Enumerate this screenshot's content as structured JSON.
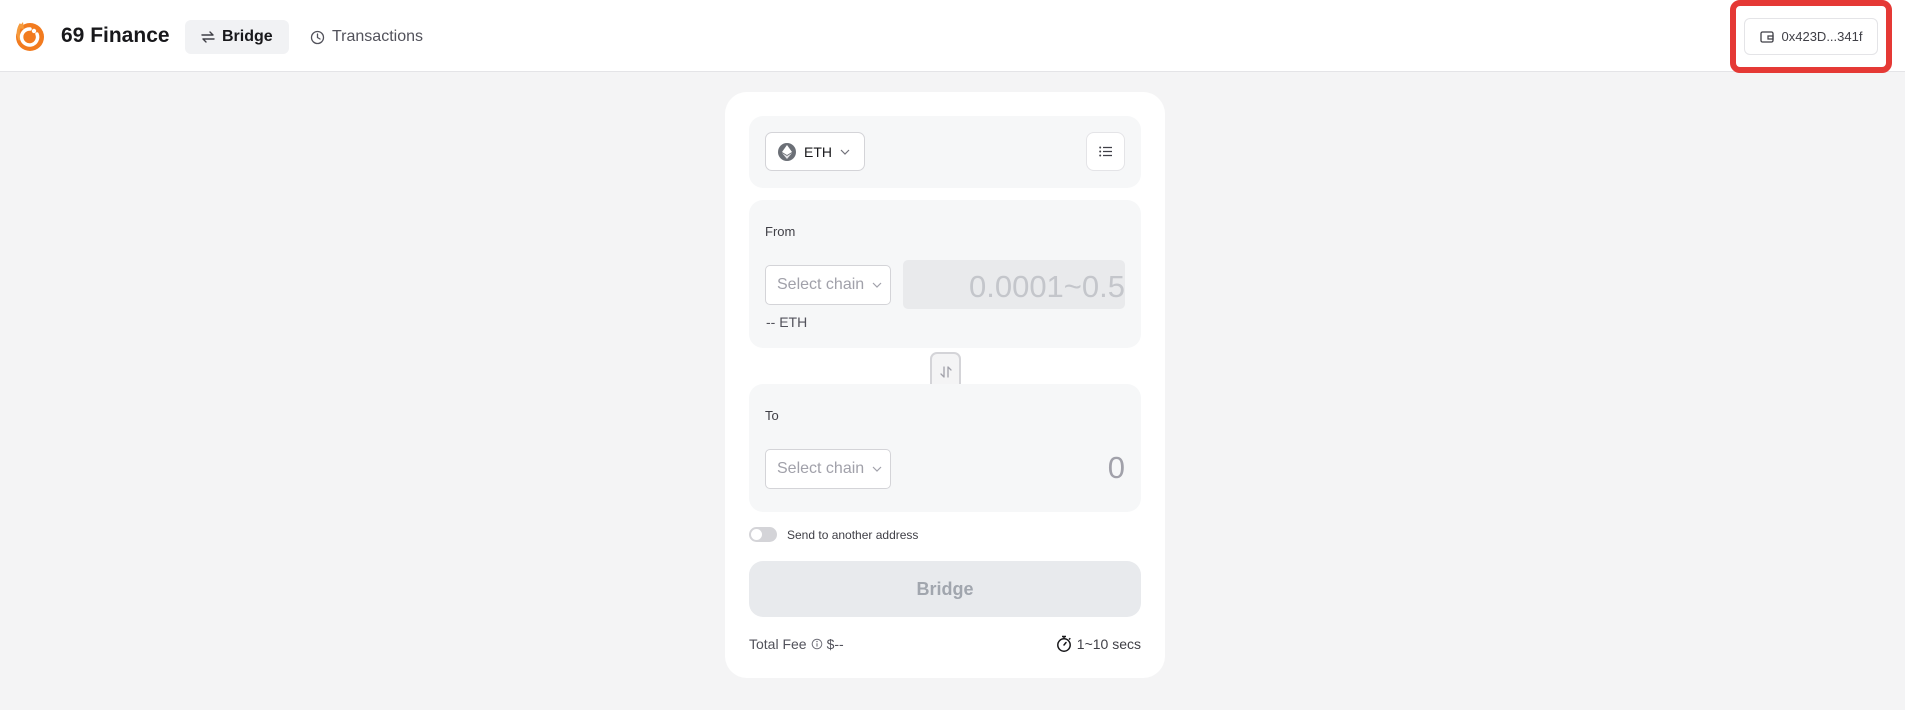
{
  "header": {
    "brand": "69 Finance",
    "tabs": [
      {
        "label": "Bridge",
        "active": true,
        "icon": "swap-arrows-icon"
      },
      {
        "label": "Transactions",
        "active": false,
        "icon": "history-icon"
      }
    ],
    "wallet": {
      "address": "0x423D...341f",
      "icon": "wallet-icon"
    }
  },
  "bridge": {
    "token": {
      "symbol": "ETH",
      "icon": "eth-icon"
    },
    "from": {
      "label": "From",
      "chain_placeholder": "Select chain",
      "amount_placeholder": "0.0001~0.5",
      "balance": "-- ETH"
    },
    "to": {
      "label": "To",
      "chain_placeholder": "Select chain",
      "amount": "0"
    },
    "send_to_another": {
      "label": "Send to another address",
      "enabled": false
    },
    "submit_label": "Bridge",
    "fee": {
      "label": "Total Fee",
      "value": "$--"
    },
    "time": {
      "value": "1~10 secs",
      "icon": "stopwatch-icon"
    }
  },
  "colors": {
    "accent_orange": "#f27b1f",
    "highlight_red": "#e53935",
    "background": "#f4f4f5"
  }
}
